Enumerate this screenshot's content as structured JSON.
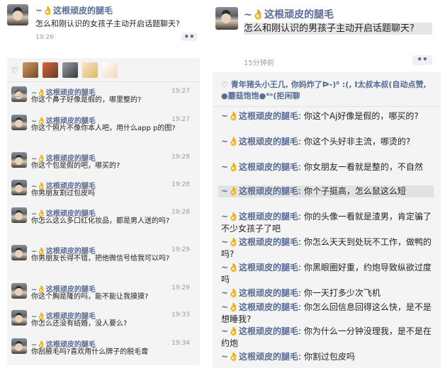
{
  "left": {
    "username": "~👌这根顽皮的腿毛",
    "post_text": "怎么和刚认识的女孩子主动开启话题聊天?",
    "time": "19:26",
    "more": "••",
    "comments": [
      {
        "name": "~👌这根顽皮的腿毛",
        "time": "19:27",
        "text": "你这个鼻子好像是假的，哪里整的?"
      },
      {
        "name": "~👌这根顽皮的腿毛",
        "time": "19:27",
        "text": "你这个照片不像你本人吧，用什么app p的图?"
      },
      {
        "name": "~👌这根顽皮的腿毛",
        "time": "19:28",
        "text": "你这个包是假的吧，哪买的?"
      },
      {
        "name": "~👌这根顽皮的腿毛",
        "time": "19:28",
        "text": "你男朋友割过包皮吗"
      },
      {
        "name": "~👌这根顽皮的腿毛",
        "time": "19:28",
        "text": "你怎么这么多口红化妆品，都是男人送的吗?"
      },
      {
        "name": "~👌这根顽皮的腿毛",
        "time": "19:29",
        "text": "你男朋友长得不错，把他微信号给我可以吗?"
      },
      {
        "name": "~👌这根顽皮的腿毛",
        "time": "19:29",
        "text": "你这个胸是隆的吗，能不能让我摸摸?"
      },
      {
        "name": "~👌这根顽皮的腿毛",
        "time": "19:33",
        "text": "你怎么还没有结婚，没人要么?"
      },
      {
        "name": "~👌这根顽皮的腿毛",
        "time": "19:34",
        "text": "你刮腋毛吗?喜欢用什么牌子的脱毛膏"
      }
    ]
  },
  "right": {
    "username": "~👌这根顽皮的腿毛",
    "post_text": "怎么和刚认识的男孩子主动开启话题聊天?",
    "time": "15分钟前",
    "more": "••",
    "likes": "♡ 青年猪头小王几, 你妈炸了ᐅ-)⁹   :(, I太叔本叔(自动点赞, ●蘑菇饱饱●⁴ᵒ(拒闲聊",
    "comments": [
      {
        "name": "~👌这根顽皮的腿毛",
        "text": ": 你这个Aj好像是假的，哪买的?"
      },
      {
        "name": "~👌这根顽皮的腿毛",
        "text": ": 你这个头好非主流，哪烫的?"
      },
      {
        "name": "~👌这根顽皮的腿毛",
        "text": ": 你女朋友一看就是整的，不自然"
      },
      {
        "name": "~👌这根顽皮的腿毛",
        "text": ": 你个子挺高，怎么鼠这么短"
      },
      {
        "name": "~👌这根顽皮的腿毛",
        "text": ": 你的头像一看就是渣男，肯定骗了不少女孩子了吧"
      },
      {
        "name": "~👌这根顽皮的腿毛",
        "text": ": 你怎么天天到处玩不工作，做鸭的吗?"
      },
      {
        "name": "~👌这根顽皮的腿毛",
        "text": ": 你黑眼圈好重，约炮导致纵欲过度吗"
      },
      {
        "name": "~👌这根顽皮的腿毛",
        "text": ": 你一天打多少次飞机"
      },
      {
        "name": "~👌这根顽皮的腿毛",
        "text": ": 你怎么回信息回得这么快，是不是想睡我?"
      },
      {
        "name": "~👌这根顽皮的腿毛",
        "text": ": 你为什么一分钟没理我，是不是在约炮"
      },
      {
        "name": "~👌这根顽皮的腿毛",
        "text": ": 你割过包皮吗"
      }
    ]
  },
  "colors": {
    "username": "#576b95",
    "comment_bg": "#f4f4f4",
    "highlight": "#e2e2e2"
  }
}
